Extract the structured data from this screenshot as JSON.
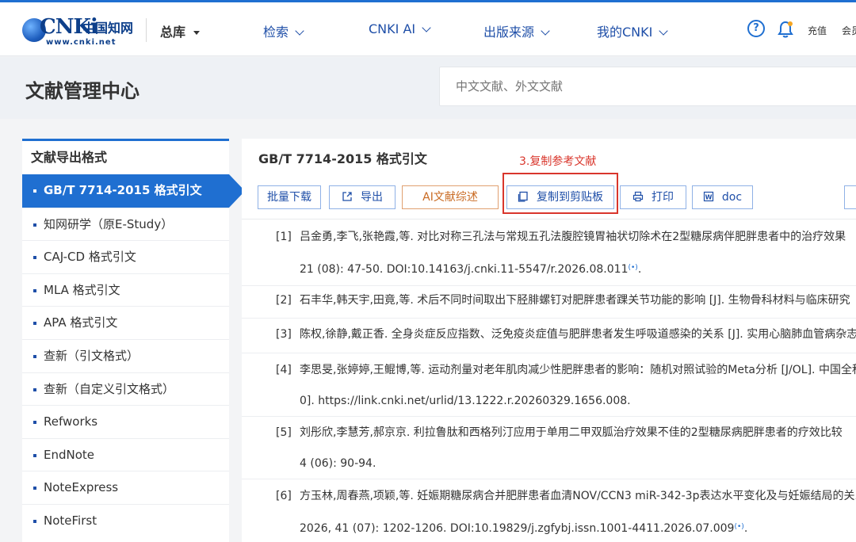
{
  "header": {
    "logo_mark": "CNKi",
    "logo_cn": "中国知网",
    "logo_url": "www.cnki.net",
    "library": "总库",
    "nav": [
      "检索",
      "CNKI AI",
      "出版来源",
      "我的CNKI"
    ],
    "help": "?",
    "recharge": "充值",
    "member": "会员"
  },
  "title_band": {
    "title": "文献管理中心",
    "search_placeholder": "中文文献、外文文献"
  },
  "sidebar": {
    "heading": "文献导出格式",
    "items": [
      "GB/T 7714-2015 格式引文",
      "知网研学（原E-Study）",
      "CAJ-CD 格式引文",
      "MLA 格式引文",
      "APA 格式引文",
      "查新（引文格式）",
      "查新（自定义引文格式）",
      "Refworks",
      "EndNote",
      "NoteExpress",
      "NoteFirst"
    ],
    "active_index": 0
  },
  "main": {
    "title": "GB/T 7714-2015 格式引文",
    "annotation": "3.复制参考文献",
    "toolbar": {
      "batch_download": "批量下载",
      "export": "导出",
      "ai_review": "AI文献综述",
      "copy_clipboard": "复制到剪贴板",
      "print": "打印",
      "doc": "doc"
    },
    "references": [
      {
        "num": "[1]",
        "line1": "吕金勇,李飞,张艳霞,等. 对比对称三孔法与常规五孔法腹腔镜胃袖状切除术在2型糖尿病伴肥胖患者中的治疗效果",
        "line2": "21 (08): 47-50. DOI:10.14163/j.cnki.11-5547/r.2026.08.011"
      },
      {
        "num": "[2]",
        "line1": "石丰华,韩天宇,田竟,等. 术后不同时间取出下胫腓螺钉对肥胖患者踝关节功能的影响 [J]. 生物骨科材料与临床研究",
        "line2": ""
      },
      {
        "num": "[3]",
        "line1": "陈权,徐静,戴正香. 全身炎症反应指数、泛免疫炎症值与肥胖患者发生呼吸道感染的关系 [J]. 实用心脑肺血管病杂志",
        "line2": ""
      },
      {
        "num": "[4]",
        "line1": "李思旻,张婷婷,王鲲博,等. 运动剂量对老年肌肉减少性肥胖患者的影响：随机对照试验的Meta分析 [J/OL]. 中国全科医学",
        "line2": "0]. https://link.cnki.net/urlid/13.1222.r.20260329.1656.008."
      },
      {
        "num": "[5]",
        "line1": "刘彤欣,李慧芳,郝京京. 利拉鲁肽和西格列汀应用于单用二甲双胍治疗效果不佳的2型糖尿病肥胖患者的疗效比较",
        "line2": "4 (06): 90-94."
      },
      {
        "num": "[6]",
        "line1": "方玉林,周春燕,项颖,等. 妊娠期糖尿病合并肥胖患者血清NOV/CCN3 miR-342-3p表达水平变化及与妊娠结局的关系",
        "line2": "2026, 41 (07): 1202-1206. DOI:10.19829/j.zgfybj.issn.1001-4411.2026.07.009"
      }
    ],
    "link_glyph": "(•)"
  }
}
